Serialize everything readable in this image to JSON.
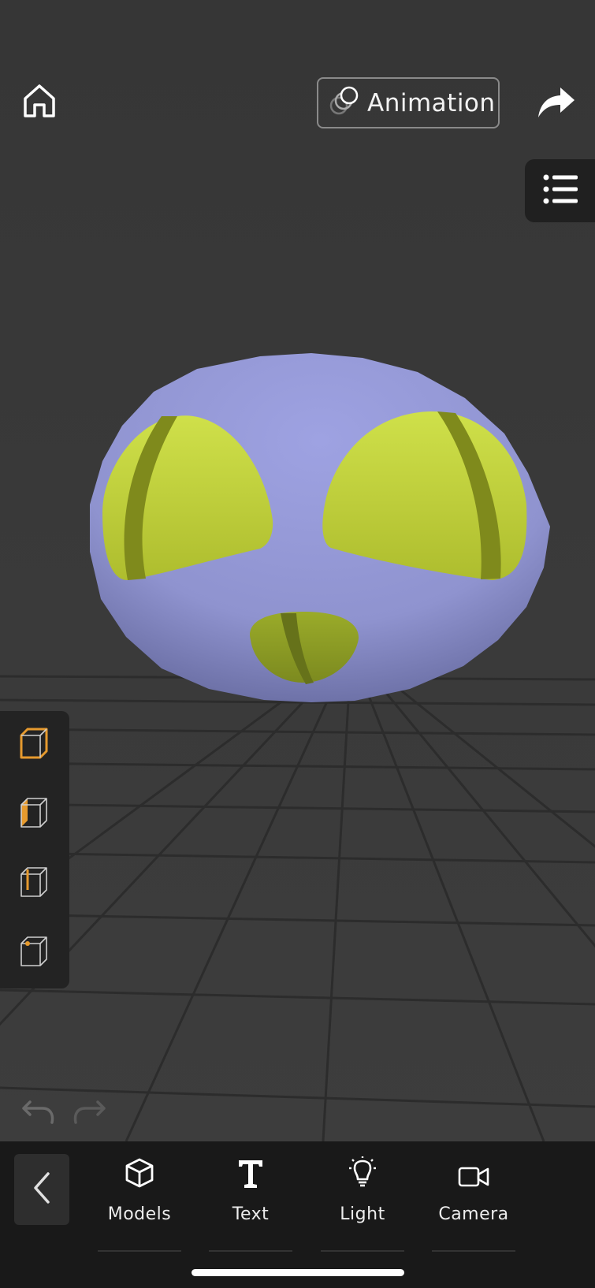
{
  "toolbar": {
    "animation_label": "Animation"
  },
  "colors": {
    "background": "#3a3a3a",
    "panel": "#232323",
    "bottom_bar": "#191919",
    "accent": "#e69a2e",
    "model_body": "#9599d6",
    "model_eyes": "#c5d93f",
    "model_stripes": "#7f8a1c"
  },
  "view_panel": {
    "items": [
      {
        "icon": "cube-outline-icon",
        "selected": true
      },
      {
        "icon": "cube-face-icon",
        "selected": false
      },
      {
        "icon": "cube-edge-icon",
        "selected": false
      },
      {
        "icon": "cube-vertex-icon",
        "selected": false
      }
    ]
  },
  "bottom_nav": {
    "tabs": [
      {
        "label": "Models",
        "icon": "cube-icon"
      },
      {
        "label": "Text",
        "icon": "text-t-icon"
      },
      {
        "label": "Light",
        "icon": "lightbulb-icon"
      },
      {
        "label": "Camera",
        "icon": "video-camera-icon"
      }
    ]
  }
}
